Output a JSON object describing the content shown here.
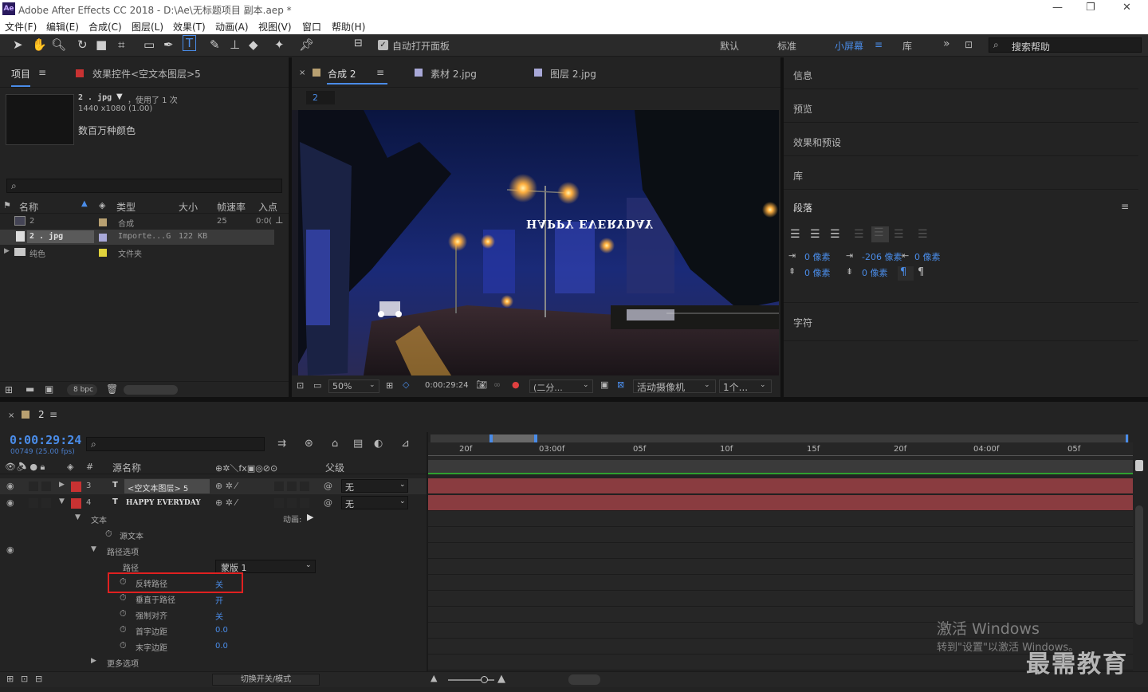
{
  "window": {
    "app_icon": "Ae",
    "title": "Adobe After Effects CC 2018 - D:\\Ae\\无标题项目 副本.aep *"
  },
  "menu": [
    "文件(F)",
    "编辑(E)",
    "合成(C)",
    "图层(L)",
    "效果(T)",
    "动画(A)",
    "视图(V)",
    "窗口",
    "帮助(H)"
  ],
  "toolbar": {
    "auto_open": "自动打开面板",
    "workspaces": [
      "默认",
      "标准",
      "小屏幕",
      "库"
    ],
    "search": "搜索帮助"
  },
  "project": {
    "tab": "项目",
    "effect_tab": "效果控件<空文本图层>5",
    "preview_name": "2 . jpg",
    "preview_used": "，使用了 1 次",
    "preview_dims": "1440 x1080 (1.00)",
    "preview_color": "数百万种颜色",
    "columns": [
      "名称",
      "类型",
      "大小",
      "帧速率",
      "入点"
    ],
    "items": [
      {
        "name": "2",
        "type": "合成",
        "size": "",
        "fps": "25",
        "in": "0:0("
      },
      {
        "name": "2 . jpg",
        "type": "Importe...G",
        "size": "122 KB",
        "fps": "",
        "in": ""
      },
      {
        "name": "纯色",
        "type": "文件夹",
        "size": "",
        "fps": "",
        "in": ""
      }
    ],
    "bpc": "8 bpc"
  },
  "comp": {
    "tabs": [
      "合成 2",
      "素材 2.jpg",
      "图层 2.jpg"
    ],
    "breadcrumb": "2",
    "overlay_text": "HAPPY EVERYDAY",
    "zoom": "50%",
    "timecode": "0:00:29:24",
    "resolution": "(二分...",
    "camera": "活动摄像机",
    "views": "1个..."
  },
  "right_panels": [
    "信息",
    "预览",
    "效果和预设",
    "库"
  ],
  "paragraph": {
    "title": "段落",
    "vals": [
      "0 像素",
      "-206 像素",
      "0 像素",
      "0 像素",
      "0 像素"
    ],
    "char_title": "字符"
  },
  "timeline": {
    "comp": "2",
    "time": "0:00:29:24",
    "fps": "00749 (25.00 fps)",
    "header_source": "源名称",
    "header_parent": "父级",
    "layers": [
      {
        "num": "3",
        "name": "<空文本图层> 5",
        "parent": "无"
      },
      {
        "num": "4",
        "name": "HAPPY EVERYDAY",
        "parent": "无"
      }
    ],
    "props": {
      "text": "文本",
      "animate": "动画:",
      "source_text": "源文本",
      "path_options": "路径选项",
      "path": "路径",
      "path_val": "蒙版 1",
      "reverse": "反转路径",
      "reverse_val": "关",
      "perp": "垂直于路径",
      "perp_val": "开",
      "force": "强制对齐",
      "force_val": "关",
      "first": "首字边距",
      "first_val": "0.0",
      "last": "末字边距",
      "last_val": "0.0",
      "more": "更多选项"
    },
    "ruler": [
      "20f",
      "03:00f",
      "05f",
      "10f",
      "15f",
      "20f",
      "04:00f",
      "05f"
    ],
    "toggle_mode": "切换开关/模式"
  },
  "watermark": {
    "activate": "激活 Windows",
    "activate_sub": "转到\"设置\"以激活 Windows。",
    "brand": "最需教育"
  }
}
